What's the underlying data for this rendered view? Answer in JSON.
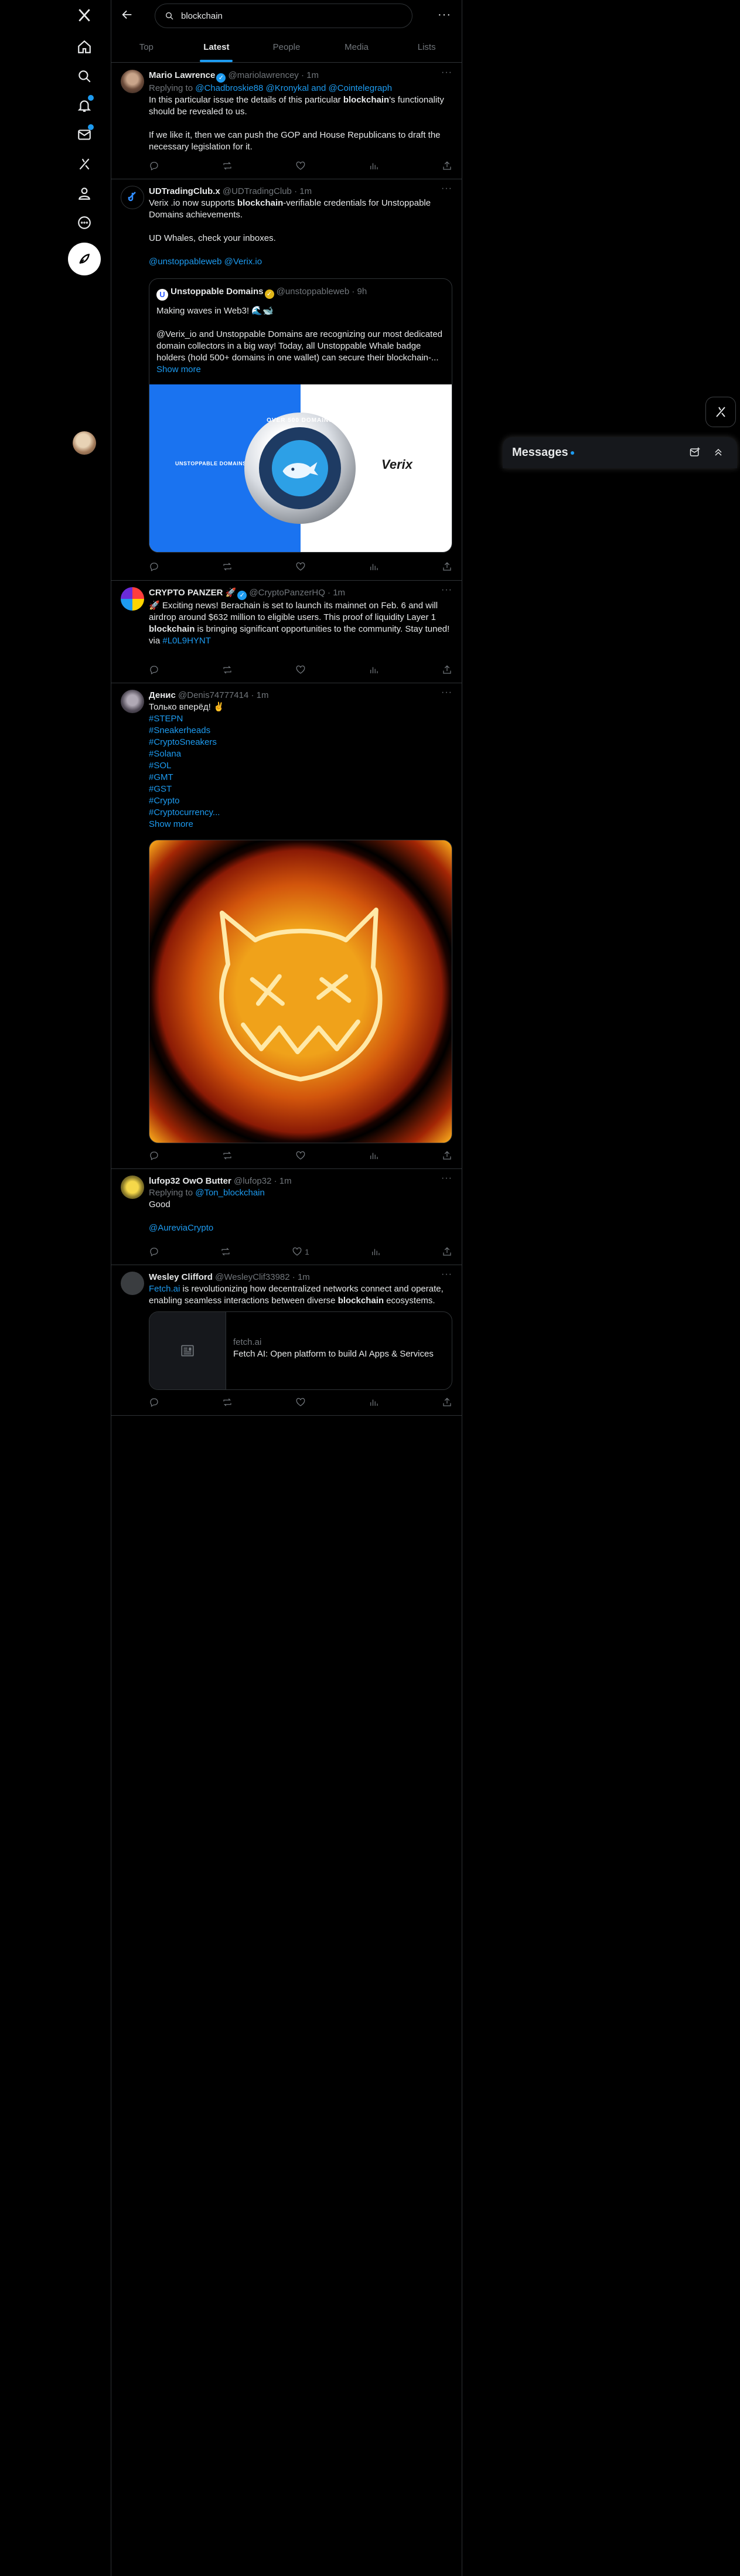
{
  "search": {
    "value": "blockchain"
  },
  "tabs": [
    {
      "label": "Top"
    },
    {
      "label": "Latest"
    },
    {
      "label": "People"
    },
    {
      "label": "Media"
    },
    {
      "label": "Lists"
    }
  ],
  "messages": {
    "title": "Messages"
  },
  "tweets": [
    {
      "name": "Mario Lawrence",
      "handle": "@mariolawrencey",
      "time": "· 1m",
      "replying_label": "Replying to",
      "replying_to": "@Chadbroskie88 @Kronykal and @Cointelegraph",
      "text1_a": "In this particular issue the details of this particular ",
      "text1_b": "blockchain",
      "text1_c": "'s functionality should be revealed to us.",
      "text2": "If we like it, then we can push the GOP and House Republicans to draft the necessary legislation for it."
    },
    {
      "name": "UDTradingClub.x",
      "handle": "@UDTradingClub",
      "time": "· 1m",
      "text1_a": "Verix .io now supports ",
      "text1_b": "blockchain",
      "text1_c": "-verifiable credentials for Unstoppable Domains achievements.",
      "text2": "UD Whales, check your inboxes.",
      "text3": "@unstoppableweb @Verix.io",
      "quote": {
        "name": "Unstoppable Domains",
        "handle": "@unstoppableweb",
        "time": "· 9h",
        "line1": "Making waves in Web3! 🌊🐋",
        "line2": "@Verix_io and Unstoppable Domains are recognizing our most dedicated domain collectors in a big way! Today, all Unstoppable Whale badge holders (hold 500+ domains in one wallet) can secure their blockchain-...",
        "show_more": "Show more",
        "brand_left": "UNSTOPPABLE DOMAINS",
        "badge_text": "OVER 500 DOMAINS",
        "brand_right": "Verix"
      }
    },
    {
      "name": "CRYPTO PANZER 🚀",
      "handle": "@CryptoPanzerHQ",
      "time": "· 1m",
      "text1_a": "🚀 Exciting news! Berachain is set to launch its mainnet on Feb. 6 and will airdrop around $632 million to eligible users. This proof of liquidity Layer 1 ",
      "text1_b": "blockchain",
      "text1_c": " is bringing significant opportunities to the community. Stay tuned!",
      "via_label": "via",
      "via_link": "#L0L9HYNT"
    },
    {
      "name": "Денис",
      "handle": "@Denis74777414",
      "time": "· 1m",
      "text1": "Только вперёд! ✌️",
      "hashtags": [
        "#STEPN",
        "#Sneakerheads",
        "#CryptoSneakers",
        "#Solana",
        "#SOL",
        "#GMT",
        "#GST",
        "#Crypto",
        "#Cryptocurrency..."
      ],
      "show_more": "Show more"
    },
    {
      "name": "lufop32 OwO Butter",
      "handle": "@lufop32",
      "time": "· 1m",
      "replying_label": "Replying to",
      "replying_to": "@Ton_blockchain",
      "text1": "Good",
      "text2": "@AureviaCrypto",
      "like_count": "1"
    },
    {
      "name": "Wesley Clifford",
      "handle": "@WesleyClif33982",
      "time": "· 1m",
      "text1_a": "Fetch.ai",
      "text1_b": " is revolutionizing how decentralized networks connect and operate, enabling seamless interactions between diverse ",
      "text1_c": "blockchain",
      "text1_d": " ecosystems.",
      "card": {
        "domain": "fetch.ai",
        "title": "Fetch AI: Open platform to build AI Apps & Services"
      }
    }
  ],
  "colors": {
    "accent": "#1d9bf0",
    "border": "#2f3336",
    "muted": "#71767b"
  }
}
